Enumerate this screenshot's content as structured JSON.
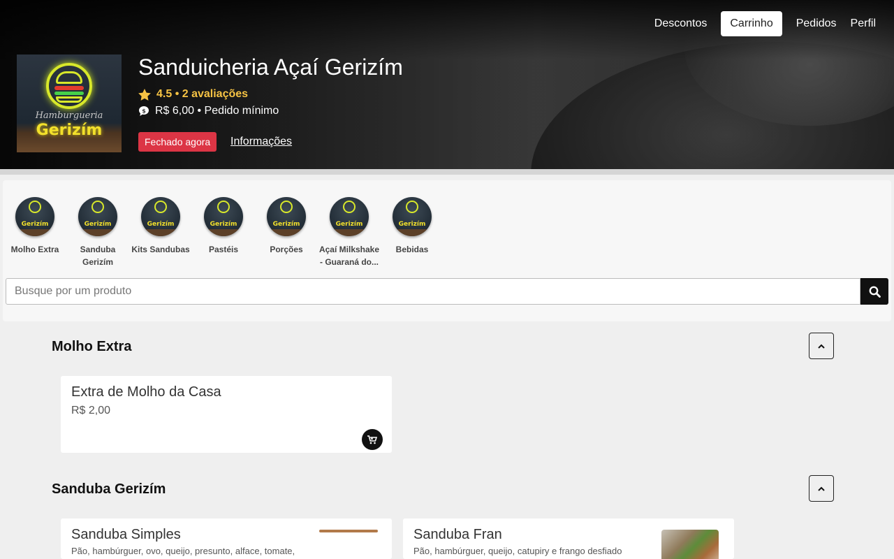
{
  "nav": {
    "items": [
      {
        "label": "Descontos"
      },
      {
        "label": "Carrinho"
      },
      {
        "label": "Pedidos"
      },
      {
        "label": "Perfil"
      }
    ]
  },
  "store": {
    "logo_script": "Hamburgueria",
    "logo_brand": "Gerizím",
    "name": "Sanduicheria Açaí Gerizím",
    "rating": "4.5 • 2 avaliações",
    "min_order": "R$ 6,00 • Pedido mínimo",
    "status": "Fechado agora",
    "info_link": "Informações"
  },
  "categories": [
    {
      "label": "Molho Extra"
    },
    {
      "label": "Sanduba Gerizím"
    },
    {
      "label": "Kits Sandubas"
    },
    {
      "label": "Pastéis"
    },
    {
      "label": "Porções"
    },
    {
      "label": "Açaí Milkshake - Guaraná do..."
    },
    {
      "label": "Bebidas"
    }
  ],
  "search": {
    "placeholder": "Busque por um produto",
    "value": ""
  },
  "sections": [
    {
      "title": "Molho Extra",
      "products": [
        {
          "name": "Extra de Molho da Casa",
          "price": "R$ 2,00"
        }
      ]
    },
    {
      "title": "Sanduba Gerizím",
      "products": [
        {
          "name": "Sanduba Simples",
          "description": "Pão, hambúrguer, ovo, queijo, presunto, alface, tomate,"
        },
        {
          "name": "Sanduba Fran",
          "description": "Pão, hambúrguer, queijo, catupiry e frango desfiado"
        }
      ]
    }
  ],
  "icons": {
    "rating": "star-icon",
    "min_order": "money-icon",
    "search": "search-icon",
    "collapse": "chevron-up-icon",
    "cart": "cart-icon"
  },
  "colors": {
    "status_badge": "#dc3545",
    "rating": "#f6c344",
    "search_button": "#111111"
  }
}
